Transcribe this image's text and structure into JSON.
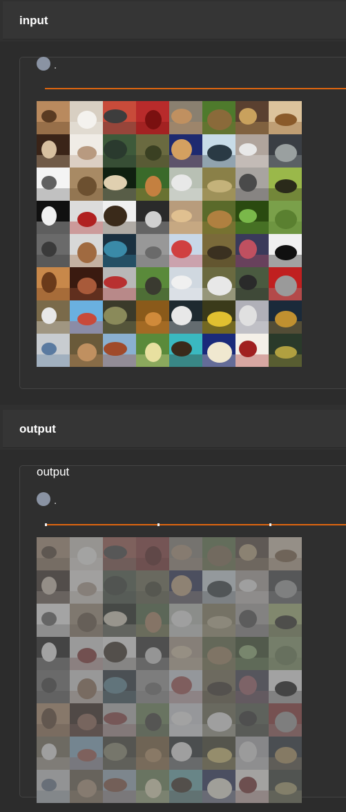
{
  "sections": {
    "input": {
      "header": "input",
      "dot_text": "."
    },
    "output": {
      "header": "output",
      "panel_label": "output",
      "dot_text": "."
    }
  },
  "colors": {
    "accent": "#e0660f",
    "background": "#303030",
    "header_bg": "#353535",
    "dot": "#8a93a3"
  },
  "tiles": [
    [
      "#b98a5e",
      "#5a3b22",
      "#d8cfc2",
      "#f4f2ee",
      "#c84b3a",
      "#3d3d3d",
      "#b82b2b",
      "#7a1010",
      "#8a8070",
      "#c09060",
      "#4e7a2c",
      "#8a6a3a",
      "#5a4030",
      "#c9a15d",
      "#dcc39c",
      "#8a5a2a"
    ],
    [
      "#3a2418",
      "#d8c0a0",
      "#f0ece6",
      "#b89a80",
      "#3e5a3a",
      "#2a3a2e",
      "#6a6a40",
      "#3a4022",
      "#1e2a70",
      "#d4a060",
      "#c8dce8",
      "#2a3a44",
      "#b0a49c",
      "#e8e8e8",
      "#3a3e44",
      "#9aa0a0"
    ],
    [
      "#f4f4f4",
      "#606060",
      "#a88a64",
      "#6c5030",
      "#102010",
      "#e0d0b0",
      "#3a6a2a",
      "#c48040",
      "#b8c0b4",
      "#e8e8e8",
      "#8a8048",
      "#c4b27a",
      "#a8a4a0",
      "#4a4a4a",
      "#9ab84a",
      "#2a2a1a"
    ],
    [
      "#101010",
      "#f0f0f0",
      "#dcdcdc",
      "#b02020",
      "#f0f0f0",
      "#3a2a1a",
      "#2a2a2a",
      "#d0d0d0",
      "#b89c7c",
      "#e0c090",
      "#5a6a2a",
      "#b08040",
      "#2a4a10",
      "#7ab84a",
      "#7aa04a",
      "#5a8030"
    ],
    [
      "#6a6a6a",
      "#3a3a3a",
      "#d8d8d8",
      "#a06a40",
      "#1a3040",
      "#3a8aa8",
      "#989898",
      "#6a6a6a",
      "#c8d8e8",
      "#d04040",
      "#7a6a3a",
      "#3a3020",
      "#3a3a5a",
      "#c05060",
      "#f0f0f0",
      "#101010"
    ],
    [
      "#c8884a",
      "#6a3a1a",
      "#3a1a10",
      "#a85a3a",
      "#b8b8b8",
      "#b83030",
      "#5a8a3a",
      "#3a3a30",
      "#d0d8e0",
      "#f0f0f0",
      "#6a6a40",
      "#e8e8e8",
      "#4a5a40",
      "#2a2a2a",
      "#c02020",
      "#9a9a9a"
    ],
    [
      "#7a6a4a",
      "#e8e8e8",
      "#6ab0e0",
      "#c84a3a",
      "#3a3a2a",
      "#8a8a5a",
      "#8a5a1a",
      "#d08a3a",
      "#1e2a30",
      "#e8e8e8",
      "#3a3a1a",
      "#e0c030",
      "#b0b0b8",
      "#e0e0e0",
      "#1a2a3a",
      "#c09030"
    ],
    [
      "#c8ccd0",
      "#5a7aa0",
      "#6a5a3a",
      "#c09060",
      "#8ab0d0",
      "#a04a2a",
      "#5a8a3a",
      "#e8e0a0",
      "#3ab8c0",
      "#3a2a1a",
      "#1a2a7a",
      "#f0e8d0",
      "#f4f0e8",
      "#a02020",
      "#2a3a2a",
      "#b0a040"
    ]
  ]
}
